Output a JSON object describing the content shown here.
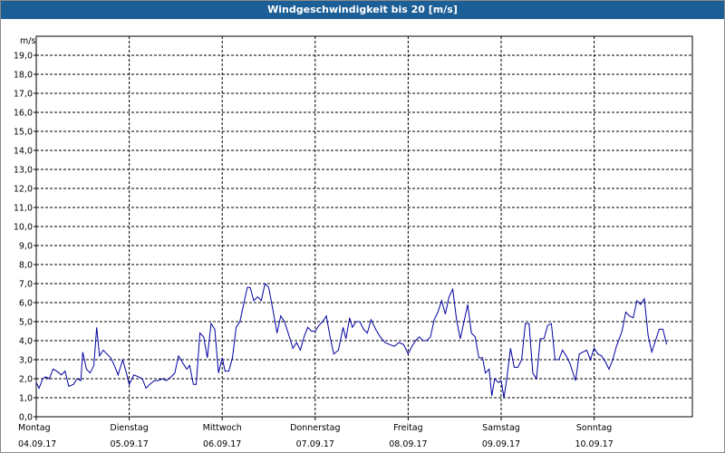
{
  "window": {
    "title": "Windgeschwindigkeit bis 20 [m/s]"
  },
  "colors": {
    "titlebar": "#1c5f97",
    "series": "#0000a0",
    "grid": "#000000"
  },
  "chart_data": {
    "type": "line",
    "title": "Windgeschwindigkeit bis 20 [m/s]",
    "ylabel": "m/s",
    "ylim": [
      0,
      20
    ],
    "grid": true,
    "y_ticks": [
      "0,0",
      "1,0",
      "2,0",
      "3,0",
      "4,0",
      "5,0",
      "6,0",
      "7,0",
      "8,0",
      "9,0",
      "10,0",
      "11,0",
      "12,0",
      "13,0",
      "14,0",
      "15,0",
      "16,0",
      "17,0",
      "18,0",
      "19,0"
    ],
    "days": [
      {
        "name": "Montag",
        "date": "04.09.17"
      },
      {
        "name": "Dienstag",
        "date": "05.09.17"
      },
      {
        "name": "Mittwoch",
        "date": "06.09.17"
      },
      {
        "name": "Donnerstag",
        "date": "07.09.17"
      },
      {
        "name": "Freitag",
        "date": "08.09.17"
      },
      {
        "name": "Samstag",
        "date": "09.09.17"
      },
      {
        "name": "Sonntag",
        "date": "10.09.17"
      }
    ],
    "x_unit": "days since 04.09.17 00:00",
    "series": [
      {
        "values": [
          [
            0.0,
            1.8
          ],
          [
            0.03,
            1.5
          ],
          [
            0.07,
            2.0
          ],
          [
            0.1,
            2.1
          ],
          [
            0.14,
            2.0
          ],
          [
            0.18,
            2.5
          ],
          [
            0.22,
            2.4
          ],
          [
            0.27,
            2.2
          ],
          [
            0.31,
            2.4
          ],
          [
            0.35,
            1.6
          ],
          [
            0.4,
            1.7
          ],
          [
            0.44,
            2.0
          ],
          [
            0.48,
            1.9
          ],
          [
            0.5,
            3.4
          ],
          [
            0.54,
            2.5
          ],
          [
            0.58,
            2.3
          ],
          [
            0.62,
            2.7
          ],
          [
            0.65,
            4.7
          ],
          [
            0.68,
            3.2
          ],
          [
            0.72,
            3.5
          ],
          [
            0.76,
            3.3
          ],
          [
            0.8,
            3.1
          ],
          [
            0.84,
            2.7
          ],
          [
            0.88,
            2.2
          ],
          [
            0.93,
            3.0
          ],
          [
            0.97,
            2.3
          ],
          [
            1.0,
            1.7
          ],
          [
            1.05,
            2.2
          ],
          [
            1.1,
            2.1
          ],
          [
            1.14,
            2.0
          ],
          [
            1.18,
            1.5
          ],
          [
            1.22,
            1.7
          ],
          [
            1.27,
            1.9
          ],
          [
            1.31,
            1.9
          ],
          [
            1.36,
            2.0
          ],
          [
            1.4,
            1.9
          ],
          [
            1.45,
            2.1
          ],
          [
            1.49,
            2.3
          ],
          [
            1.53,
            3.2
          ],
          [
            1.58,
            2.8
          ],
          [
            1.62,
            2.5
          ],
          [
            1.65,
            2.7
          ],
          [
            1.69,
            1.7
          ],
          [
            1.72,
            1.7
          ],
          [
            1.76,
            4.4
          ],
          [
            1.8,
            4.2
          ],
          [
            1.84,
            3.1
          ],
          [
            1.88,
            4.9
          ],
          [
            1.92,
            4.6
          ],
          [
            1.96,
            2.3
          ],
          [
            2.0,
            3.1
          ],
          [
            2.03,
            2.4
          ],
          [
            2.07,
            2.4
          ],
          [
            2.11,
            3.1
          ],
          [
            2.15,
            4.7
          ],
          [
            2.19,
            5.0
          ],
          [
            2.23,
            5.9
          ],
          [
            2.27,
            6.8
          ],
          [
            2.3,
            6.8
          ],
          [
            2.34,
            6.1
          ],
          [
            2.38,
            6.3
          ],
          [
            2.42,
            6.1
          ],
          [
            2.46,
            7.0
          ],
          [
            2.5,
            6.8
          ],
          [
            2.55,
            5.5
          ],
          [
            2.59,
            4.4
          ],
          [
            2.63,
            5.3
          ],
          [
            2.67,
            5.0
          ],
          [
            2.71,
            4.4
          ],
          [
            2.76,
            3.6
          ],
          [
            2.8,
            3.9
          ],
          [
            2.84,
            3.5
          ],
          [
            2.88,
            4.2
          ],
          [
            2.92,
            4.7
          ],
          [
            2.96,
            4.5
          ],
          [
            3.0,
            4.5
          ],
          [
            3.04,
            4.8
          ],
          [
            3.08,
            5.0
          ],
          [
            3.12,
            5.3
          ],
          [
            3.16,
            4.2
          ],
          [
            3.2,
            3.3
          ],
          [
            3.25,
            3.5
          ],
          [
            3.3,
            4.7
          ],
          [
            3.33,
            4.1
          ],
          [
            3.37,
            5.2
          ],
          [
            3.4,
            4.7
          ],
          [
            3.44,
            5.0
          ],
          [
            3.48,
            5.0
          ],
          [
            3.52,
            4.6
          ],
          [
            3.56,
            4.4
          ],
          [
            3.6,
            5.1
          ],
          [
            3.65,
            4.6
          ],
          [
            3.7,
            4.2
          ],
          [
            3.75,
            3.9
          ],
          [
            3.8,
            3.8
          ],
          [
            3.85,
            3.7
          ],
          [
            3.9,
            3.9
          ],
          [
            3.95,
            3.8
          ],
          [
            4.0,
            3.3
          ],
          [
            4.04,
            3.7
          ],
          [
            4.08,
            4.0
          ],
          [
            4.12,
            4.2
          ],
          [
            4.16,
            4.0
          ],
          [
            4.2,
            4.0
          ],
          [
            4.24,
            4.2
          ],
          [
            4.28,
            5.1
          ],
          [
            4.32,
            5.5
          ],
          [
            4.36,
            6.1
          ],
          [
            4.4,
            5.4
          ],
          [
            4.44,
            6.3
          ],
          [
            4.48,
            6.7
          ],
          [
            4.52,
            5.1
          ],
          [
            4.56,
            4.1
          ],
          [
            4.6,
            5.0
          ],
          [
            4.64,
            5.9
          ],
          [
            4.68,
            4.4
          ],
          [
            4.72,
            4.2
          ],
          [
            4.76,
            3.1
          ],
          [
            4.8,
            3.1
          ],
          [
            4.83,
            2.3
          ],
          [
            4.87,
            2.5
          ],
          [
            4.9,
            1.1
          ],
          [
            4.93,
            2.0
          ],
          [
            4.97,
            1.8
          ],
          [
            5.0,
            1.9
          ],
          [
            5.03,
            1.0
          ],
          [
            5.06,
            2.0
          ],
          [
            5.1,
            3.6
          ],
          [
            5.14,
            2.6
          ],
          [
            5.18,
            2.6
          ],
          [
            5.22,
            3.0
          ],
          [
            5.26,
            4.9
          ],
          [
            5.3,
            4.9
          ],
          [
            5.34,
            2.3
          ],
          [
            5.38,
            2.0
          ],
          [
            5.42,
            4.1
          ],
          [
            5.46,
            4.1
          ],
          [
            5.5,
            4.8
          ],
          [
            5.54,
            4.9
          ],
          [
            5.58,
            3.0
          ],
          [
            5.62,
            3.0
          ],
          [
            5.66,
            3.5
          ],
          [
            5.7,
            3.2
          ],
          [
            5.74,
            2.8
          ],
          [
            5.8,
            1.9
          ],
          [
            5.84,
            3.3
          ],
          [
            5.88,
            3.4
          ],
          [
            5.92,
            3.5
          ],
          [
            5.96,
            3.0
          ],
          [
            6.0,
            3.6
          ],
          [
            6.04,
            3.3
          ],
          [
            6.08,
            3.2
          ],
          [
            6.12,
            2.9
          ],
          [
            6.16,
            2.5
          ],
          [
            6.2,
            3.0
          ],
          [
            6.24,
            3.7
          ],
          [
            6.3,
            4.5
          ],
          [
            6.34,
            5.5
          ],
          [
            6.38,
            5.3
          ],
          [
            6.42,
            5.2
          ],
          [
            6.46,
            6.1
          ],
          [
            6.5,
            5.9
          ],
          [
            6.54,
            6.2
          ],
          [
            6.58,
            4.3
          ],
          [
            6.62,
            3.4
          ],
          [
            6.66,
            4.0
          ],
          [
            6.7,
            4.6
          ],
          [
            6.74,
            4.6
          ],
          [
            6.78,
            3.8
          ]
        ]
      }
    ]
  }
}
